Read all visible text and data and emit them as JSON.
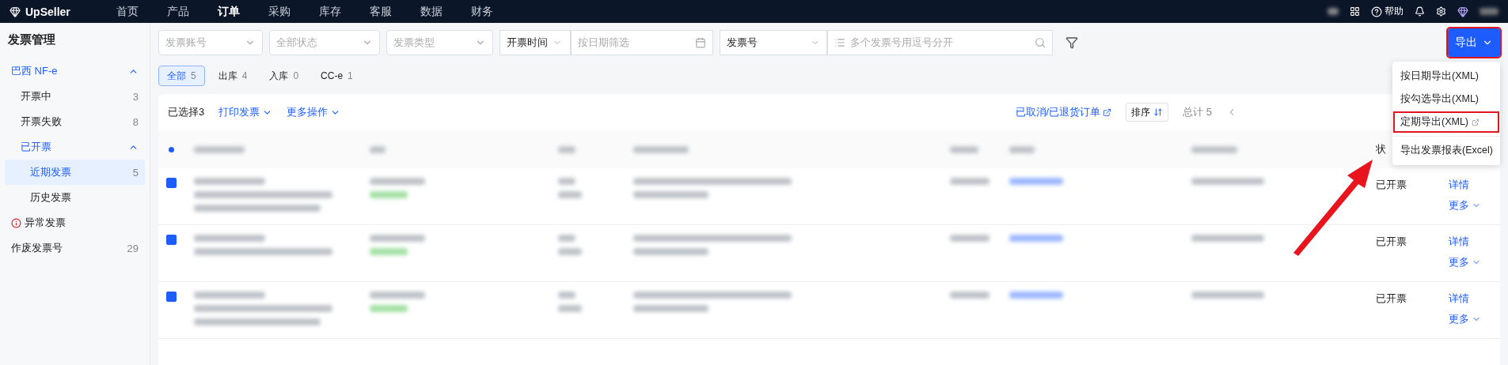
{
  "topnav": {
    "logo": "UpSeller",
    "items": [
      {
        "label": "首页",
        "selected": false
      },
      {
        "label": "产品",
        "selected": false
      },
      {
        "label": "订单",
        "selected": true
      },
      {
        "label": "采购",
        "selected": false
      },
      {
        "label": "库存",
        "selected": false
      },
      {
        "label": "客服",
        "selected": false
      },
      {
        "label": "数据",
        "selected": false
      },
      {
        "label": "财务",
        "selected": false
      }
    ],
    "help": "帮助"
  },
  "sidebar": {
    "title": "发票管理",
    "items": [
      {
        "label": "巴西 NF-e",
        "kind": "group",
        "expanded": true,
        "selected": true,
        "children": [
          {
            "label": "开票中",
            "count": "3",
            "selected": false
          },
          {
            "label": "开票失败",
            "count": "8",
            "selected": false
          },
          {
            "label": "已开票",
            "kind": "group",
            "expanded": true,
            "selected": true,
            "children": [
              {
                "label": "近期发票",
                "count": "5",
                "selected": true
              },
              {
                "label": "历史发票",
                "selected": false
              }
            ]
          }
        ]
      },
      {
        "label": "异常发票",
        "kind": "warning",
        "selected": false
      },
      {
        "label": "作废发票号",
        "count": "29",
        "selected": false
      }
    ]
  },
  "filters": {
    "account": {
      "placeholder": "发票账号"
    },
    "status": {
      "placeholder": "全部状态"
    },
    "type": {
      "placeholder": "发票类型"
    },
    "time": {
      "value": "开票时间",
      "placeholder": "按日期筛选"
    },
    "number": {
      "value": "发票号",
      "placeholder": "多个发票号用逗号分开"
    }
  },
  "export": {
    "label": "导出",
    "expanded": true,
    "menu": [
      {
        "label": "按日期导出(XML)",
        "highlighted": false,
        "external": false
      },
      {
        "label": "按勾选导出(XML)",
        "highlighted": false,
        "external": false
      },
      {
        "label": "定期导出(XML)",
        "highlighted": true,
        "external": true
      },
      {
        "label": "导出发票报表(Excel)",
        "highlighted": false,
        "external": false
      }
    ]
  },
  "tabs": [
    {
      "label": "全部",
      "count": "5",
      "selected": true
    },
    {
      "label": "出库",
      "count": "4",
      "selected": false
    },
    {
      "label": "入库",
      "count": "0",
      "selected": false
    },
    {
      "label": "CC-e",
      "count": "1",
      "selected": false
    }
  ],
  "toolbar": {
    "selected": "已选择3",
    "print": "打印发票",
    "more": "更多操作",
    "cancelled_link": "已取消/已退货订单",
    "sort": "排序",
    "total": "总计 5"
  },
  "table": {
    "status_header": "状",
    "rows": [
      {
        "checked": true,
        "status": "已开票",
        "detail": "详情",
        "more": "更多"
      },
      {
        "checked": true,
        "status": "已开票",
        "detail": "详情",
        "more": "更多"
      },
      {
        "checked": true,
        "status": "已开票",
        "detail": "详情",
        "more": "更多"
      }
    ]
  }
}
